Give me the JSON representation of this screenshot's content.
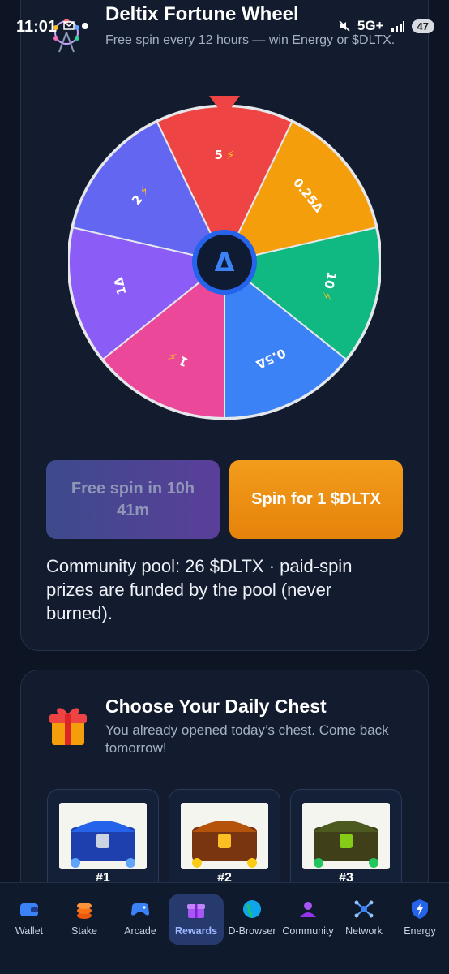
{
  "status_bar": {
    "time": "11:01",
    "network": "5G+",
    "battery": "47"
  },
  "wheel": {
    "title": "Deltix Fortune Wheel",
    "subtitle": "Free spin every 12 hours — win Energy or $DLTX.",
    "center_symbol": "Δ",
    "segments": [
      {
        "label": "5",
        "icon": "lightning-icon",
        "color": "#ef4444"
      },
      {
        "label": "0.25Δ",
        "icon": "",
        "color": "#f59e0b"
      },
      {
        "label": "10",
        "icon": "lightning-icon",
        "color": "#10b981"
      },
      {
        "label": "0.5Δ",
        "icon": "",
        "color": "#3b82f6"
      },
      {
        "label": "1",
        "icon": "lightning-icon",
        "color": "#ec4899"
      },
      {
        "label": "1Δ",
        "icon": "",
        "color": "#8b5cf6"
      },
      {
        "label": "2",
        "icon": "lightning-icon",
        "color": "#6366f1"
      }
    ],
    "free_spin_button": "Free spin in 10h 41m",
    "paid_spin_button": "Spin for 1 $DLTX",
    "pool_text": "Community pool: 26 $DLTX · paid-spin prizes are funded by the pool (never burned)."
  },
  "chest": {
    "title": "Choose Your Daily Chest",
    "subtitle": "You already opened today’s chest. Come back tomorrow!",
    "items": [
      {
        "label": "#1",
        "theme": "blue"
      },
      {
        "label": "#2",
        "theme": "gold"
      },
      {
        "label": "#3",
        "theme": "green"
      }
    ]
  },
  "nav": {
    "items": [
      {
        "label": "Wallet",
        "icon": "wallet-icon"
      },
      {
        "label": "Stake",
        "icon": "coins-icon"
      },
      {
        "label": "Arcade",
        "icon": "gamepad-icon"
      },
      {
        "label": "Rewards",
        "icon": "gift-icon",
        "active": true
      },
      {
        "label": "D-Browser",
        "icon": "globe-icon"
      },
      {
        "label": "Community",
        "icon": "community-icon"
      },
      {
        "label": "Network",
        "icon": "network-icon"
      },
      {
        "label": "Energy",
        "icon": "energy-shield-icon"
      }
    ]
  }
}
